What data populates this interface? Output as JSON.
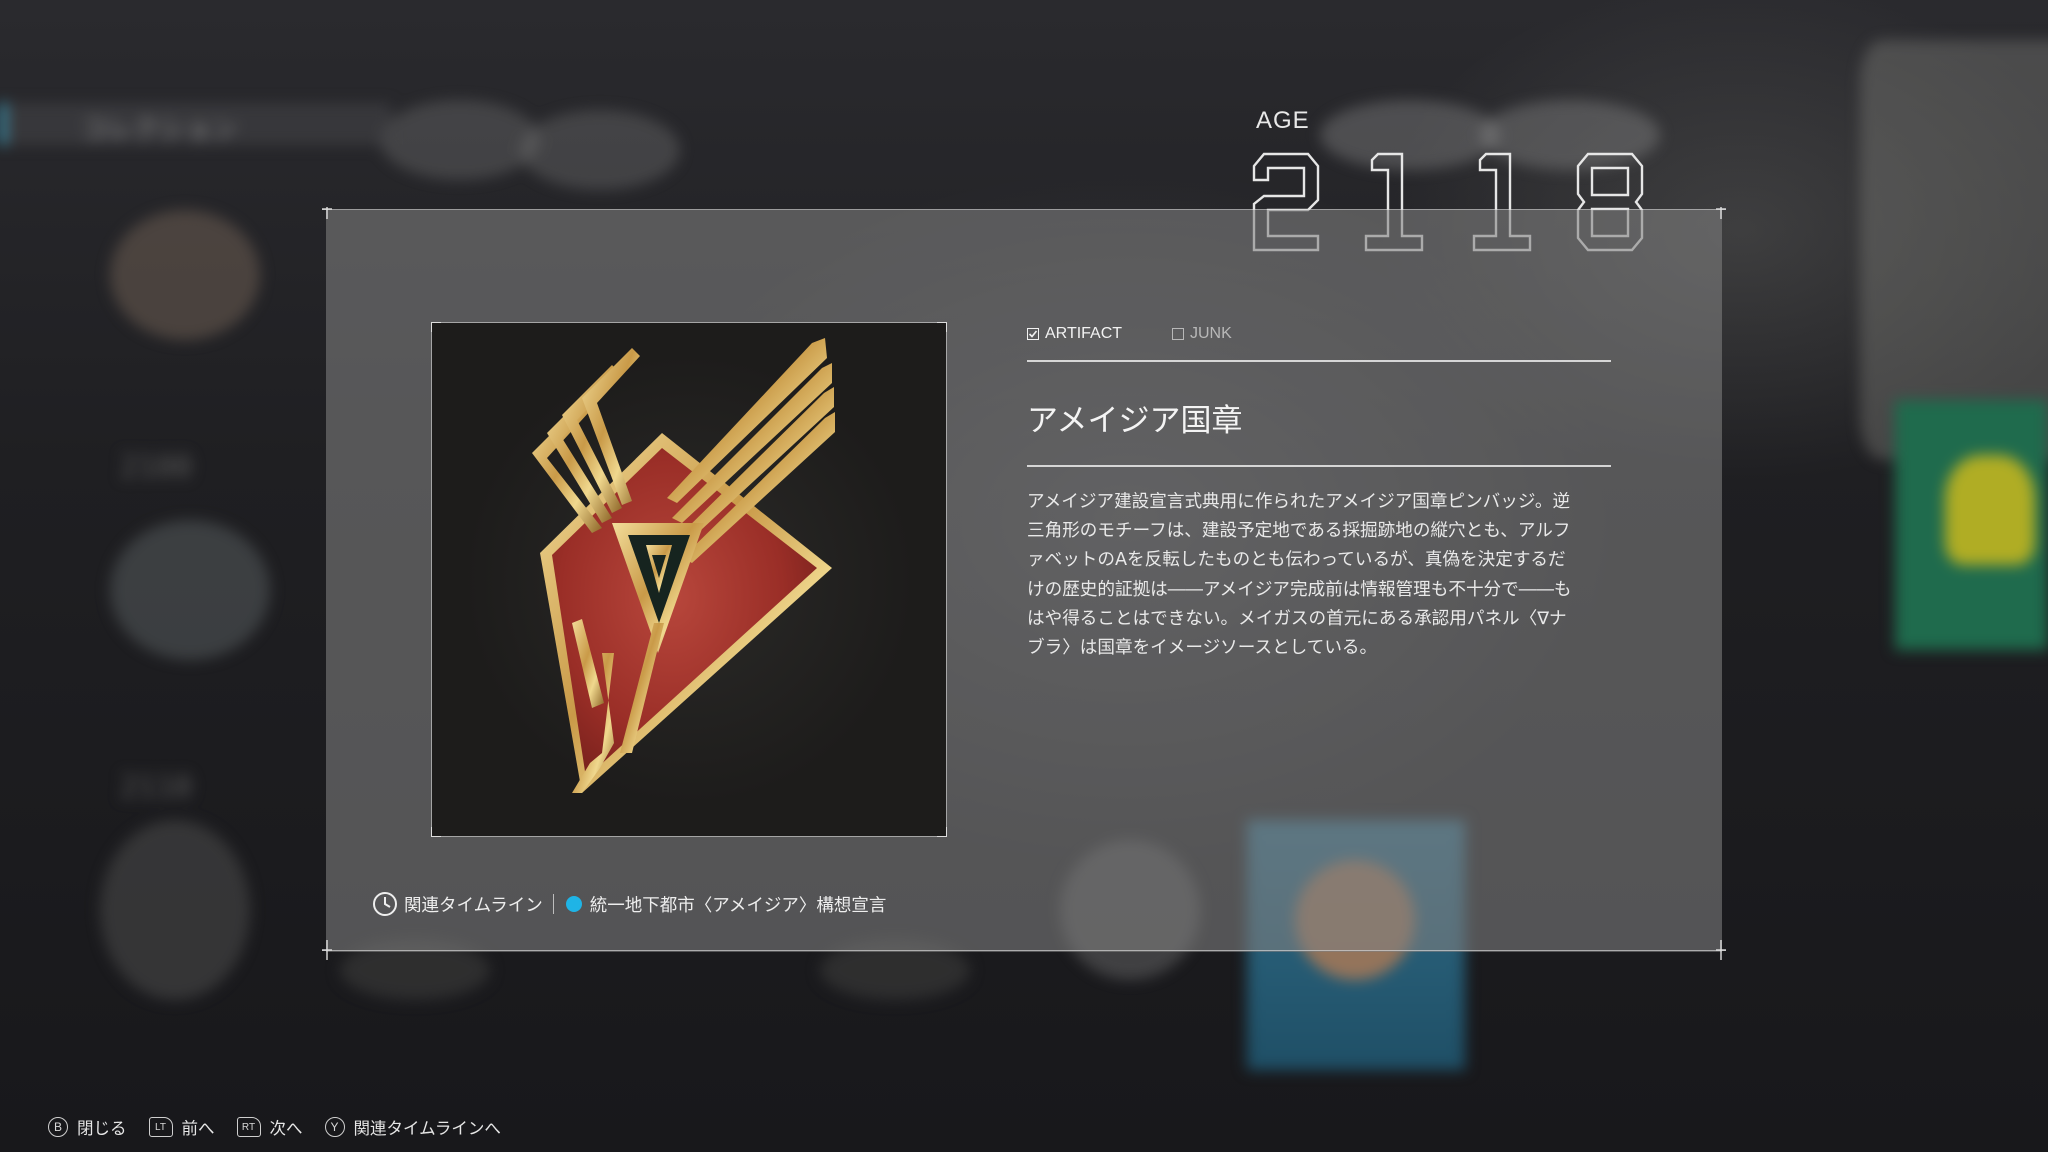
{
  "age": {
    "label": "AGE",
    "value": "2118",
    "digits": [
      "2",
      "1",
      "1",
      "8"
    ]
  },
  "background": {
    "side_tab_label": "コレクション",
    "items": [
      {
        "age": "2100"
      },
      {
        "age": "2110"
      }
    ]
  },
  "tabs": [
    {
      "label": "ARTIFACT",
      "checked": true
    },
    {
      "label": "JUNK",
      "checked": false
    }
  ],
  "item": {
    "title": "アメイジア国章",
    "description_lines": [
      "アメイジア建設宣言式典用に作られたアメイジア国章ピンバッジ。逆",
      "三角形のモチーフは、建設予定地である採掘跡地の縦穴とも、アルフ",
      "ァベットのAを反転したものとも伝わっているが、真偽を決定するだ",
      "けの歴史的証拠は――アメイジア完成前は情報管理も不十分で――も",
      "はや得ることはできない。メイガスの首元にある承認用パネル〈∇ナ",
      "ブラ〉は国章をイメージソースとしている。"
    ],
    "image_icon": "amazia-emblem-pin"
  },
  "timeline": {
    "label": "関連タイムライン",
    "event": "統一地下都市〈アメイジア〉構想宣言",
    "dot_color": "#1fb4e6"
  },
  "hints": [
    {
      "button": "B",
      "label": "閉じる"
    },
    {
      "button": "LT",
      "label": "前へ"
    },
    {
      "button": "RT",
      "label": "次へ"
    },
    {
      "button": "Y",
      "label": "関連タイムラインへ"
    }
  ],
  "colors": {
    "accent": "#1fb4e6",
    "badge_red": "#a8322c",
    "badge_gold": "#d9b25e"
  }
}
